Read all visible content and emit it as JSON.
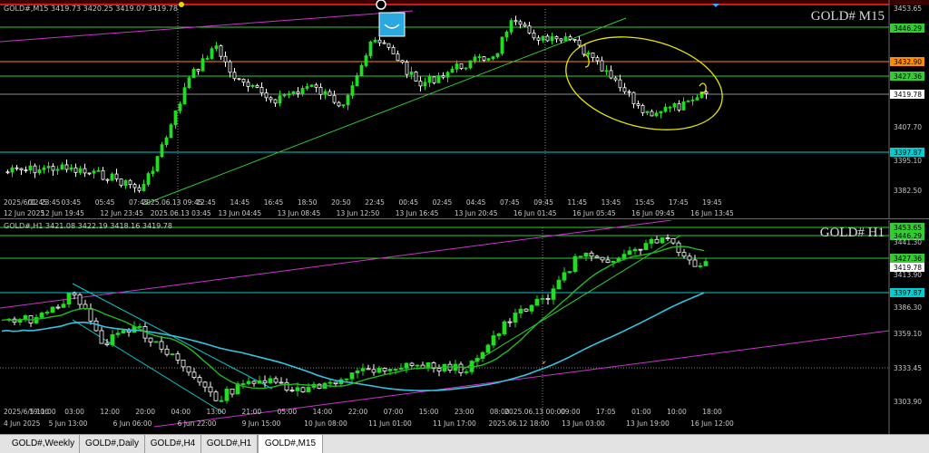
{
  "colors": {
    "bg": "#000000",
    "bull": "#22dd22",
    "bear": "#ffffff",
    "resistance": "#32cd32",
    "support_cyan": "#00ced1",
    "orange_line": "#ff8c00",
    "trend_magenta": "#cc33cc",
    "ma_fast": "#22bb22",
    "ma_slow": "#33c5e0",
    "annotation": "#e6e600",
    "price_grid": "#6a6a6a",
    "text": "#c8c8c8"
  },
  "m15": {
    "info": "GOLD#,M15  3419.73 3420.25 3419.07 3419.78",
    "watermark": "GOLD# M15",
    "price_scale": [
      "3453.65",
      "3446.29",
      "3432.90",
      "3427.36",
      "3419.78",
      "3407.70",
      "3397.87",
      "3395.10",
      "3382.50"
    ],
    "time_labels": [
      "2025/6/12 23:45",
      "01:45",
      "03:45",
      "05:45",
      "07:45",
      "2025.06.13 09:45",
      "12:45",
      "14:45",
      "16:45",
      "18:50",
      "20:50",
      "22:45",
      "00:45",
      "02:45",
      "04:45",
      "07:45",
      "09:45",
      "11:45",
      "13:45",
      "15:45",
      "17:45",
      "19:45"
    ],
    "time_labels_2": [
      "12 Jun 2025",
      "12 Jun 19:45",
      "12 Jun 23:45",
      "2025.06.13 03:45",
      "13 Jun 04:45",
      "13 Jun 08:45",
      "13 Jun 12:50",
      "13 Jun 16:45",
      "13 Jun 20:45",
      "16 Jun 01:45",
      "16 Jun 05:45",
      "16 Jun 09:45",
      "16 Jun 13:45"
    ]
  },
  "h1": {
    "info": "GOLD#,H1  3421.08 3422.19 3418.16 3419.78",
    "watermark": "GOLD# H1",
    "price_scale": [
      "3453.65",
      "3446.29",
      "3441.30",
      "3427.36",
      "3419.78",
      "3413.90",
      "3397.87",
      "3386.30",
      "3359.10",
      "3333.45",
      "3303.90"
    ],
    "time_labels": [
      "2025/6/5 11:00",
      "19:00",
      "03:00",
      "12:00",
      "20:00",
      "04:00",
      "13:00",
      "21:00",
      "05:00",
      "14:00",
      "22:00",
      "07:00",
      "15:00",
      "23:00",
      "08:00",
      "2025.06.13 00:00",
      "09:00",
      "17:05",
      "01:00",
      "10:00",
      "18:00"
    ],
    "time_labels_2": [
      "4 Jun 2025",
      "5 Jun 13:00",
      "6 Jun 06:00",
      "6 Jun 22:00",
      "9 Jun 15:00",
      "10 Jun 08:00",
      "11 Jun 01:00",
      "11 Jun 17:00",
      "2025.06.12 18:00",
      "13 Jun 03:00",
      "13 Jun 19:00",
      "16 Jun 12:00"
    ]
  },
  "tabs": [
    {
      "label": "GOLD#,Weekly",
      "active": false
    },
    {
      "label": "GOLD#,Daily",
      "active": false
    },
    {
      "label": "GOLD#,H4",
      "active": false
    },
    {
      "label": "GOLD#,H1",
      "active": false
    },
    {
      "label": "GOLD#,M15",
      "active": true
    }
  ]
}
